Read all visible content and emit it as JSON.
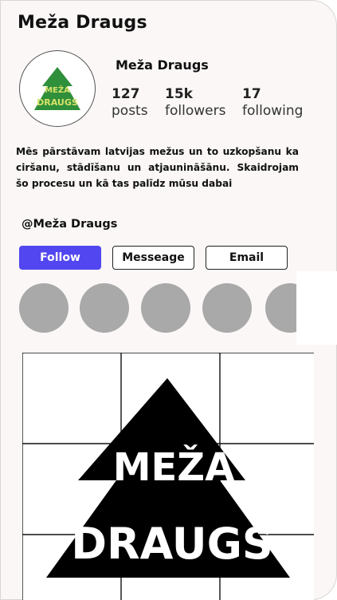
{
  "header": {
    "title": "Meža Draugs"
  },
  "profile": {
    "name": "Meža Draugs",
    "logo_text": [
      "MEŽA",
      "DRAUGS"
    ],
    "logo_bg": "#2f8f3a",
    "logo_text_color": "#d6e26a",
    "stats": [
      {
        "value": "127",
        "label": "posts"
      },
      {
        "value": "15k",
        "label": "followers"
      },
      {
        "value": "17",
        "label": "following"
      }
    ],
    "bio": "Mēs pārstāvam latvijas mežus un to uzkopšanu ka ciršanu, stādīšanu un atjaunināšānu. Skaidrojam šo procesu un kā tas palīdz mūsu dabai",
    "handle": "@Meža Draugs"
  },
  "actions": {
    "follow_label": "Follow",
    "message_label": "Messeage",
    "email_label": "Email",
    "accent": "#5146ef"
  },
  "highlights": {
    "count": 5,
    "color": "#a9a9a9"
  },
  "post": {
    "logo_text": [
      "MEŽA",
      "DRAUGS"
    ],
    "grid": "3x3"
  }
}
